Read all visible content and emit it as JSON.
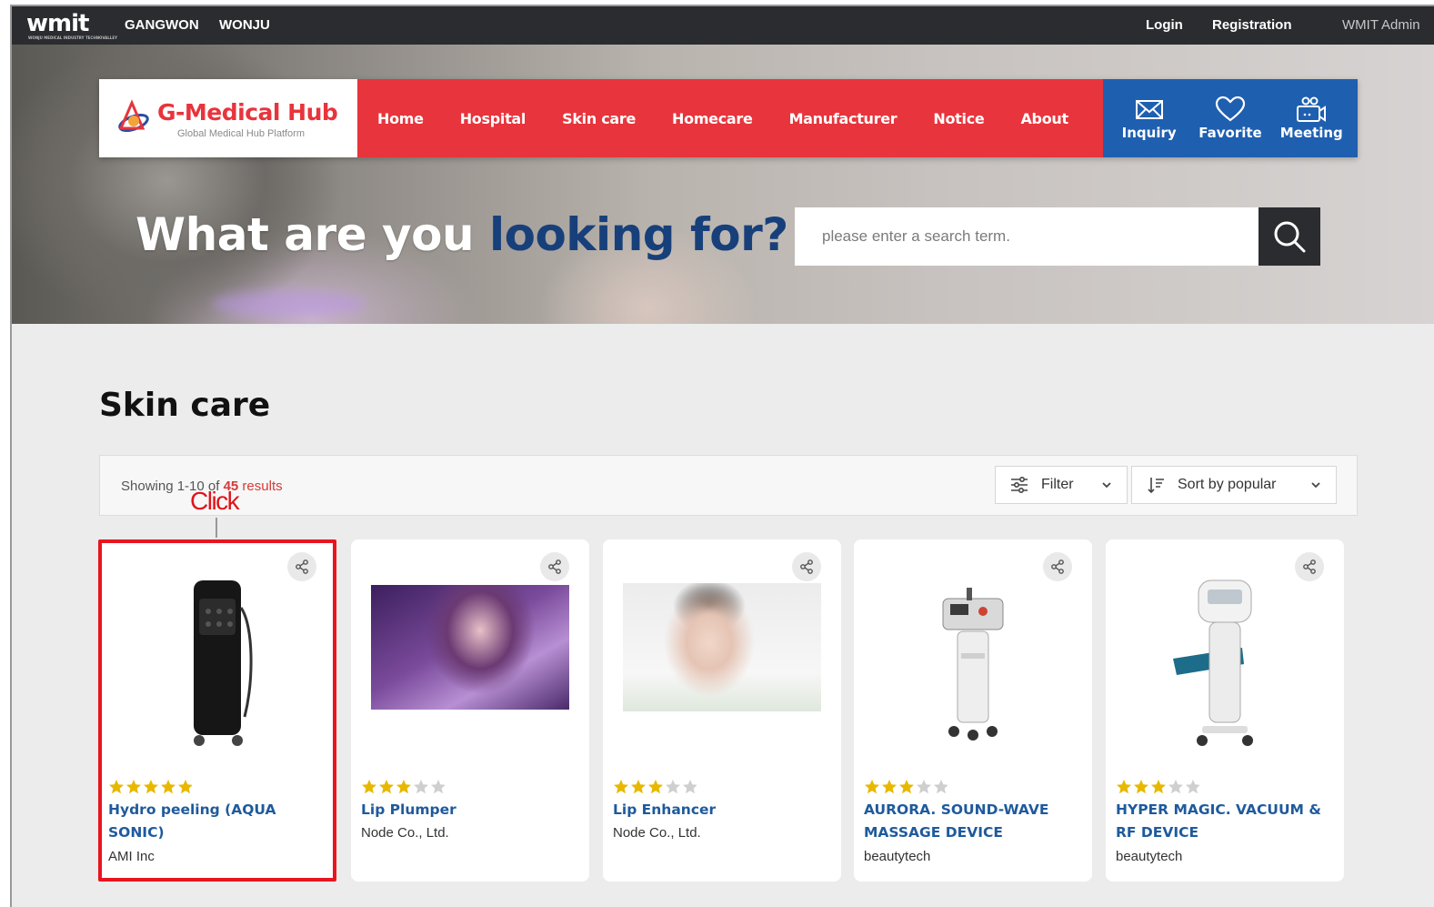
{
  "topbar": {
    "logo": "wmit",
    "logo_sub": "WONJU MEDICAL INDUSTRY TECHNOVALLEY",
    "regions": [
      "GANGWON",
      "WONJU"
    ],
    "login": "Login",
    "registration": "Registration",
    "admin": "WMIT Admin"
  },
  "brand": {
    "title": "G-Medical Hub",
    "subtitle": "Global Medical Hub Platform"
  },
  "nav": {
    "items": [
      "Home",
      "Hospital",
      "Skin care",
      "Homecare",
      "Manufacturer",
      "Notice",
      "About"
    ]
  },
  "quick": {
    "inquiry": "Inquiry",
    "favorite": "Favorite",
    "meeting": "Meeting"
  },
  "hero": {
    "headline_white": "What are you ",
    "headline_blue": "looking for?"
  },
  "search": {
    "placeholder": "please enter a search term."
  },
  "page": {
    "title": "Skin care"
  },
  "toolbar": {
    "showing_prefix": "Showing 1-10 of ",
    "total": "45",
    "showing_suffix": " results",
    "filter_label": "Filter",
    "sort_label": "Sort by popular"
  },
  "annotation": {
    "label": "Click"
  },
  "colors": {
    "brand_red": "#e8343c",
    "brand_blue": "#1e5fb0",
    "title_blue": "#1f5a9c",
    "star_gold": "#e8b800",
    "star_gray": "#cfcfcf",
    "highlight_red": "#e8151f"
  },
  "products": [
    {
      "title": "Hydro peeling (AQUA SONIC)",
      "maker": "AMI Inc",
      "rating": 5,
      "rating_max": 5,
      "image": "black-peeling-machine"
    },
    {
      "title": "Lip Plumper",
      "maker": "Node Co., Ltd.",
      "rating": 3,
      "rating_max": 5,
      "image": "lip-plumper-photo"
    },
    {
      "title": "Lip Enhancer",
      "maker": "Node Co., Ltd.",
      "rating": 3,
      "rating_max": 5,
      "image": "lip-enhancer-photo"
    },
    {
      "title": "AURORA. SOUND-WAVE MASSAGE DEVICE",
      "maker": "beautytech",
      "rating": 3,
      "rating_max": 5,
      "image": "aurora-device"
    },
    {
      "title": "HYPER MAGIC. VACUUM & RF DEVICE",
      "maker": "beautytech",
      "rating": 3,
      "rating_max": 5,
      "image": "hyper-magic-device"
    }
  ]
}
